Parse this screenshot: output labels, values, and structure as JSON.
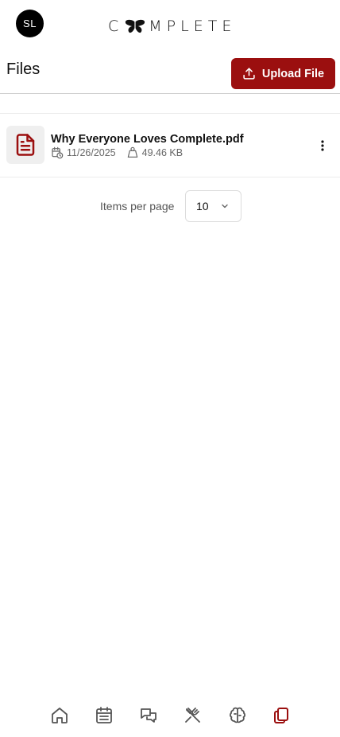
{
  "user": {
    "initials": "SL"
  },
  "brand": {
    "wordmark_left": "C",
    "wordmark_right": "MPLETE",
    "logo_icon": "butterfly-icon"
  },
  "page": {
    "title": "Files",
    "upload_label": "Upload File",
    "upload_icon": "upload-icon"
  },
  "files": [
    {
      "name": "Why Everyone Loves Complete.pdf",
      "date": "11/26/2025",
      "size": "49.46 KB",
      "icon": "document-icon"
    }
  ],
  "pagination": {
    "label": "Items per page",
    "value": "10"
  },
  "nav": {
    "items": [
      {
        "name": "home",
        "icon": "home-icon",
        "active": false
      },
      {
        "name": "calendar",
        "icon": "calendar-icon",
        "active": false
      },
      {
        "name": "messages",
        "icon": "chat-icon",
        "active": false
      },
      {
        "name": "meals",
        "icon": "utensils-icon",
        "active": false
      },
      {
        "name": "brain",
        "icon": "brain-icon",
        "active": false
      },
      {
        "name": "files",
        "icon": "files-icon",
        "active": true
      }
    ]
  },
  "colors": {
    "accent": "#9b0f0f",
    "nav_inactive": "#555555",
    "divider": "#d0d0d0"
  }
}
